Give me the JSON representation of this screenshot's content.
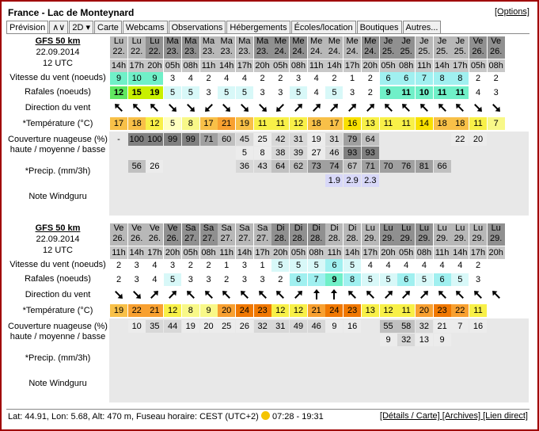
{
  "title": "France - Lac de Monteynard",
  "options": "[Options]",
  "tabs": [
    "Prévision",
    "∧∨",
    "2D ▾",
    "Carte",
    "Webcams",
    "Observations",
    "Hébergements",
    "Écoles/location",
    "Boutiques",
    "Autres..."
  ],
  "labels": {
    "model": "GFS 50 km",
    "date": "22.09.2014",
    "utc": "12 UTC",
    "wind": "Vitesse du vent (noeuds)",
    "gusts": "Rafales (noeuds)",
    "dir": "Direction du vent",
    "temp": "*Température (°C)",
    "clouds": "Couverture nuageuse (%) haute / moyenne / basse",
    "precip": "*Precip. (mm/3h)",
    "note": "Note Windguru"
  },
  "blocks": [
    {
      "days": [
        "Lu",
        "Lu",
        "Lu",
        "Ma",
        "Ma",
        "Ma",
        "Ma",
        "Ma",
        "Ma",
        "Me",
        "Me",
        "Me",
        "Me",
        "Me",
        "Me",
        "Je",
        "Je",
        "Je",
        "Je",
        "Je",
        "Ve",
        "Ve"
      ],
      "dates": [
        "22.",
        "22.",
        "22.",
        "23.",
        "23.",
        "23.",
        "23.",
        "23.",
        "23.",
        "24.",
        "24.",
        "24.",
        "24.",
        "24.",
        "24.",
        "25.",
        "25.",
        "25.",
        "25.",
        "25.",
        "26.",
        "26."
      ],
      "hours": [
        "14h",
        "17h",
        "20h",
        "05h",
        "08h",
        "11h",
        "14h",
        "17h",
        "20h",
        "05h",
        "08h",
        "11h",
        "14h",
        "17h",
        "20h",
        "05h",
        "08h",
        "11h",
        "14h",
        "17h",
        "05h",
        "08h"
      ],
      "wind": [
        "9",
        "10",
        "9",
        "3",
        "4",
        "2",
        "4",
        "4",
        "2",
        "2",
        "3",
        "4",
        "2",
        "1",
        "2",
        "6",
        "6",
        "7",
        "8",
        "8",
        "2",
        "2"
      ],
      "gust": [
        "12",
        "15",
        "19",
        "5",
        "5",
        "3",
        "5",
        "5",
        "3",
        "3",
        "5",
        "4",
        "5",
        "3",
        "2",
        "9",
        "11",
        "10",
        "11",
        "11",
        "4",
        "3"
      ],
      "dirs": [
        315,
        315,
        315,
        135,
        135,
        225,
        135,
        135,
        135,
        225,
        45,
        45,
        45,
        45,
        45,
        315,
        315,
        315,
        315,
        315,
        135,
        135
      ],
      "temp": [
        "17",
        "18",
        "12",
        "5",
        "8",
        "17",
        "21",
        "19",
        "11",
        "11",
        "12",
        "18",
        "17",
        "16",
        "13",
        "11",
        "11",
        "14",
        "18",
        "18",
        "11",
        "7",
        "8"
      ],
      "c_high": [
        "-",
        "100",
        "100",
        "99",
        "99",
        "71",
        "60",
        "45",
        "25",
        "42",
        "31",
        "19",
        "31",
        "79",
        "64",
        "",
        "",
        "",
        "",
        "22",
        "20",
        "",
        "6"
      ],
      "c_mid": [
        "",
        "",
        "",
        "",
        "",
        "",
        "",
        "5",
        "8",
        "38",
        "39",
        "27",
        "46",
        "93",
        "93",
        "",
        "",
        "",
        "",
        "",
        "",
        "",
        ""
      ],
      "c_low": [
        "",
        "56",
        "26",
        "",
        "",
        "",
        "",
        "36",
        "43",
        "64",
        "62",
        "73",
        "74",
        "67",
        "71",
        "70",
        "76",
        "81",
        "66",
        "",
        "",
        "",
        ""
      ],
      "precip": [
        "",
        "",
        "",
        "",
        "",
        "",
        "",
        "",
        "",
        "",
        "",
        "",
        "1.9",
        "2.9",
        "2.3",
        "",
        "",
        "",
        "",
        "",
        "",
        "",
        ""
      ]
    },
    {
      "days": [
        "Ve",
        "Ve",
        "Ve",
        "Ve",
        "Sa",
        "Sa",
        "Sa",
        "Sa",
        "Sa",
        "Di",
        "Di",
        "Di",
        "Di",
        "Di",
        "Lu",
        "Lu",
        "Lu",
        "Lu",
        "Lu",
        "Lu",
        "Lu",
        "Lu"
      ],
      "dates": [
        "26.",
        "26.",
        "26.",
        "26.",
        "27.",
        "27.",
        "27.",
        "27.",
        "27.",
        "28.",
        "28.",
        "28.",
        "28.",
        "28.",
        "29.",
        "29.",
        "29.",
        "29.",
        "29.",
        "29.",
        "29.",
        "29."
      ],
      "hours": [
        "11h",
        "14h",
        "17h",
        "20h",
        "05h",
        "08h",
        "11h",
        "14h",
        "17h",
        "20h",
        "05h",
        "08h",
        "11h",
        "14h",
        "17h",
        "20h",
        "05h",
        "08h",
        "11h",
        "14h",
        "17h",
        "20h"
      ],
      "wind": [
        "2",
        "3",
        "4",
        "3",
        "2",
        "2",
        "1",
        "3",
        "1",
        "5",
        "5",
        "5",
        "6",
        "5",
        "4",
        "4",
        "4",
        "4",
        "4",
        "4",
        "2",
        ""
      ],
      "gust": [
        "2",
        "3",
        "4",
        "5",
        "3",
        "3",
        "2",
        "3",
        "3",
        "2",
        "6",
        "7",
        "9",
        "8",
        "5",
        "5",
        "6",
        "5",
        "6",
        "5",
        "3",
        ""
      ],
      "dirs": [
        135,
        135,
        45,
        45,
        315,
        315,
        315,
        315,
        315,
        315,
        45,
        0,
        0,
        315,
        315,
        45,
        45,
        45,
        315,
        315,
        315,
        315
      ],
      "temp": [
        "19",
        "22",
        "21",
        "12",
        "8",
        "9",
        "20",
        "24",
        "23",
        "12",
        "12",
        "21",
        "24",
        "23",
        "13",
        "12",
        "11",
        "20",
        "23",
        "22",
        "11",
        ""
      ],
      "c_high": [
        "",
        "10",
        "35",
        "44",
        "19",
        "20",
        "25",
        "26",
        "32",
        "31",
        "49",
        "46",
        "9",
        "16",
        "",
        "55",
        "58",
        "32",
        "21",
        "7",
        "16",
        ""
      ],
      "c_mid": [
        "",
        "",
        "",
        "",
        "",
        "",
        "",
        "",
        "",
        "",
        "",
        "",
        "",
        "",
        "",
        "9",
        "32",
        "13",
        "9",
        "",
        "",
        ""
      ],
      "c_low": [
        "",
        "",
        "",
        "",
        "",
        "",
        "",
        "",
        "",
        "",
        "",
        "",
        "",
        "",
        "",
        "",
        "",
        "",
        "",
        "",
        "",
        ""
      ],
      "precip": [
        "",
        "",
        "",
        "",
        "",
        "",
        "",
        "",
        "",
        "",
        "",
        "",
        "",
        "",
        "",
        "",
        "",
        "",
        "",
        "",
        "",
        ""
      ]
    }
  ],
  "footer": {
    "left": "Lat: 44.91, Lon: 5.68, Alt: 470 m, Fuseau horaire: CEST (UTC+2)",
    "sun": "07:28 - 19:31",
    "links": "[Détails / Carte] [Archives] [Lien direct]"
  }
}
